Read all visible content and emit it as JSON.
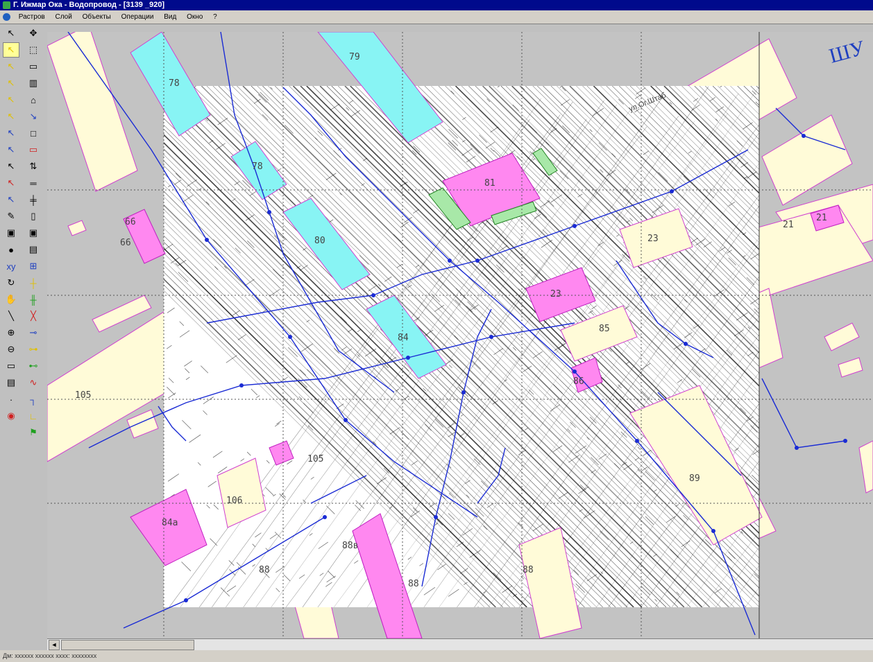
{
  "window": {
    "title": "Г. Ижмар Ока - Водопровод - [3139 _920]"
  },
  "menu": {
    "items": [
      "Растров",
      "Слой",
      "Объекты",
      "Операции",
      "Вид",
      "Окно",
      "?"
    ]
  },
  "toolbar": {
    "col1": [
      "pointer-icon",
      "select-yellow-icon",
      "select-node-icon",
      "select-edge-icon",
      "select-area-icon",
      "select-group-icon",
      "select-blue-icon",
      "select-line-icon",
      "select-point-icon",
      "select-red-icon",
      "select-shift-icon",
      "pencil-icon",
      "page-icon",
      "binoculars-icon",
      "xy-icon",
      "rotate-icon",
      "hand-icon",
      "measure-icon",
      "zoom-in-icon",
      "zoom-out-icon",
      "zoom-rect-icon",
      "zoom-layer-icon",
      "grid-icon",
      "eye-icon"
    ],
    "col2": [
      "pan-icon",
      "frame-icon",
      "layer-icon",
      "table-icon",
      "house-icon",
      "draw-line-icon",
      "rect-icon",
      "rect-red-icon",
      "move-icon",
      "align-icon",
      "split-icon",
      "document-icon",
      "save-icon",
      "print-icon",
      "net-icon",
      "node-add-icon",
      "node-move-icon",
      "node-del-icon",
      "link-icon",
      "join-icon",
      "break-icon",
      "curve-icon",
      "corner-icon",
      "angle-icon",
      "flag-icon"
    ],
    "colors": {
      "highlight": "#ffff99",
      "icon_yellow": "#e0c000",
      "icon_blue": "#2040c0",
      "icon_red": "#d02020"
    }
  },
  "map": {
    "colors": {
      "background": "#c3c3c3",
      "building_yellow": "#fffbd8",
      "building_magenta": "#ff88f0",
      "building_cyan": "#88f4f4",
      "building_green": "#a8e8a8",
      "raster": "#ffffff",
      "pipe": "#1a2bd4",
      "grid_line": "#555555"
    },
    "labels": [
      "79",
      "78",
      "78",
      "80",
      "81",
      "84",
      "23",
      "23",
      "85",
      "86",
      "89",
      "105",
      "105",
      "106",
      "84а",
      "88в",
      "88",
      "88",
      "88",
      "21",
      "21",
      "66",
      "66",
      "ШУ",
      "ул.Ог.Штаб"
    ]
  },
  "scrollbar": {
    "left_arrow": "◄"
  },
  "status": {
    "text": "Дм: хххххх хххххх   хххх: хххххххх"
  }
}
